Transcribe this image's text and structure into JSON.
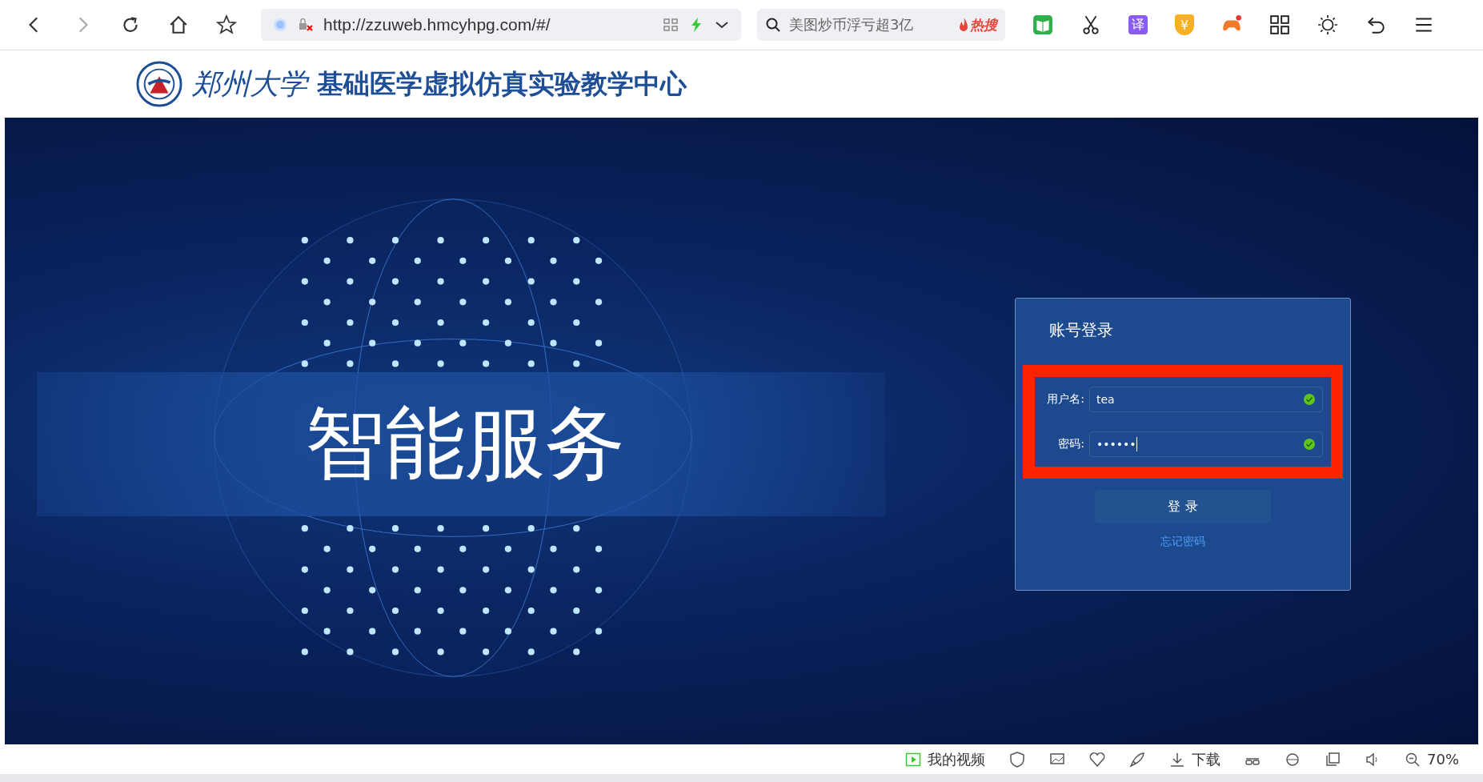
{
  "browser": {
    "url": "http://zzuweb.hmcyhpg.com/#/",
    "search_placeholder": "美图炒币浮亏超3亿",
    "hot_badge": "热搜",
    "translate_icon_label": "译",
    "coin_icon_label": "¥"
  },
  "header": {
    "university": "郑州大学",
    "title": "基础医学虚拟仿真实验教学中心"
  },
  "hero": {
    "slogan": "智能服务"
  },
  "login": {
    "title": "账号登录",
    "fields": [
      {
        "label": "用户名:",
        "value": "tea",
        "valid": true
      },
      {
        "label": "密码:",
        "value": "••••••",
        "valid": true
      }
    ],
    "highlighted": true,
    "button": "登 录",
    "forgot": "忘记密码"
  },
  "status_bar": {
    "video": "我的视频",
    "download": "下载",
    "zoom": "70%"
  }
}
